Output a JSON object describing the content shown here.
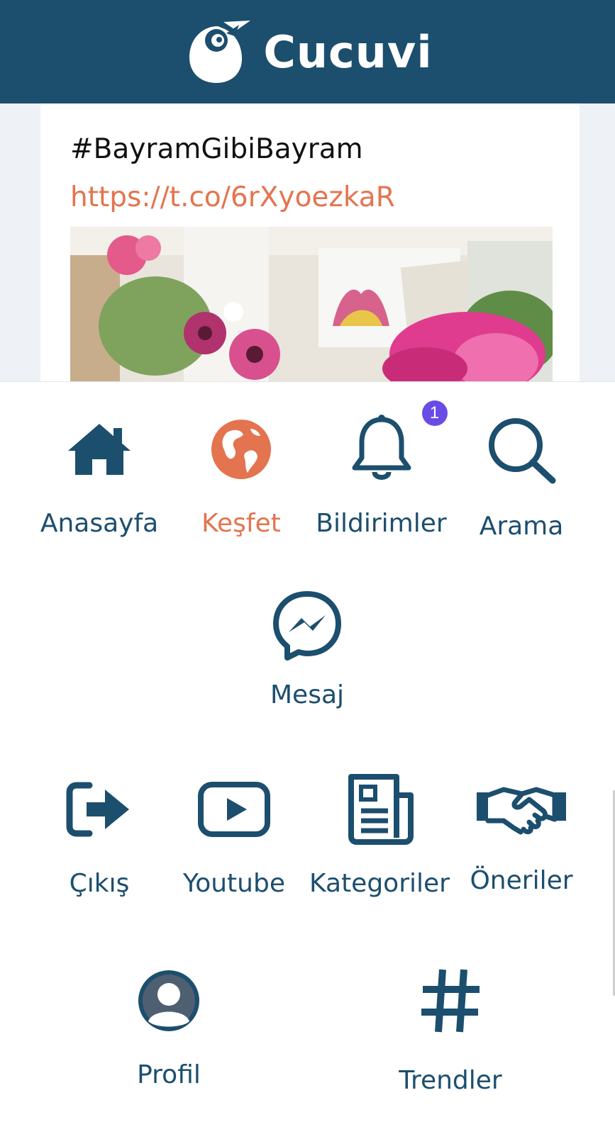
{
  "app": {
    "brand": "Cucuvi",
    "colors": {
      "header": "#1c4e6e",
      "accent": "#e4744f",
      "badge": "#6a4be6",
      "icon": "#1c4e6e"
    }
  },
  "post": {
    "text": "#BayramGibiBayram",
    "link": "https://t.co/6rXyoezkaR"
  },
  "menu": {
    "home": {
      "label": "Anasayfa",
      "icon": "home-icon"
    },
    "explore": {
      "label": "Keşfet",
      "icon": "globe-icon",
      "active": true
    },
    "notifications": {
      "label": "Bildirimler",
      "icon": "bell-icon",
      "badge": "1"
    },
    "search": {
      "label": "Arama",
      "icon": "search-icon"
    },
    "messages": {
      "label": "Mesaj",
      "icon": "messenger-icon"
    },
    "logout": {
      "label": "Çıkış",
      "icon": "sign-out-icon"
    },
    "youtube": {
      "label": "Youtube",
      "icon": "youtube-icon"
    },
    "categories": {
      "label": "Kategoriler",
      "icon": "newspaper-icon"
    },
    "suggestions": {
      "label": "Öneriler",
      "icon": "handshake-icon"
    },
    "profile": {
      "label": "Profil",
      "icon": "user-avatar-icon"
    },
    "trends": {
      "label": "Trendler",
      "icon": "hashtag-icon"
    }
  }
}
